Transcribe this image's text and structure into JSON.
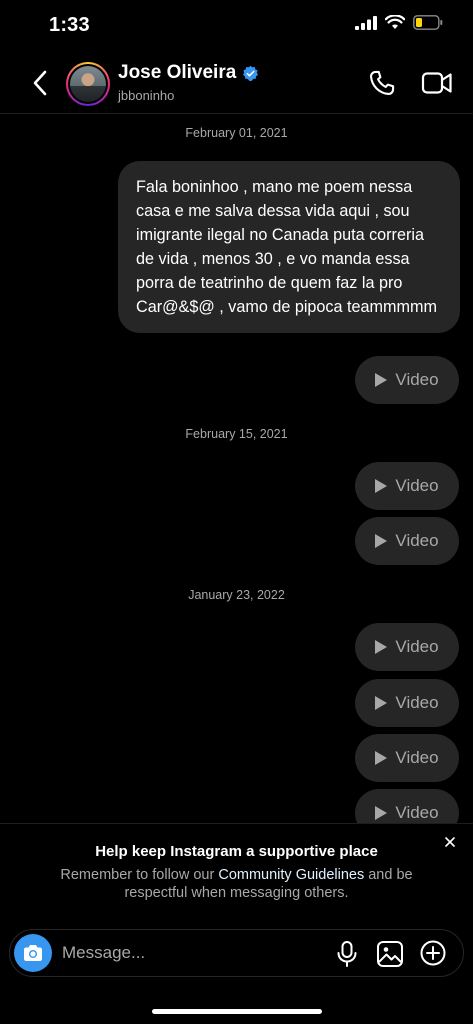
{
  "status_bar": {
    "time": "1:33"
  },
  "header": {
    "back_icon": "chevron-left-icon",
    "name": "Jose Oliveira",
    "username": "jbboninho",
    "verified_color": "#3797f0",
    "call_icon": "phone-icon",
    "video_icon": "video-camera-icon"
  },
  "thread": {
    "dates": [
      "February 01, 2021",
      "February 15, 2021",
      "January 23, 2022"
    ],
    "text_message": "Fala boninhoo , mano me poem nessa casa e me salva dessa vida aqui , sou imigrante ilegal no Canada puta correria de vida , menos 30 , e vo manda essa porra de teatrinho de quem faz la pro Car@&$@ , vamo de pipoca teammmmm",
    "video_label": "Video"
  },
  "notice": {
    "title": "Help keep Instagram a supportive place",
    "body_before": "Remember to follow our ",
    "link": "Community Guidelines",
    "body_after": " and be respectful when messaging others."
  },
  "composer": {
    "placeholder": "Message...",
    "accent": "#3797f0"
  }
}
